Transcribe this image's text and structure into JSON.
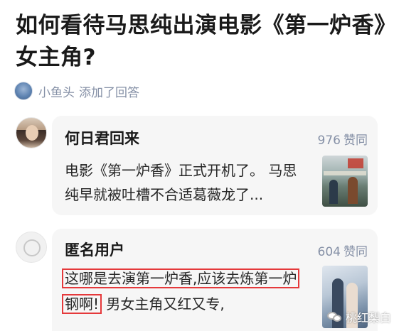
{
  "question": {
    "title": "如何看待马思纯出演电影《第一炉香》女主角?"
  },
  "activity": {
    "user": "小鱼头",
    "action": "添加了回答"
  },
  "comments": [
    {
      "author": "何日君回来",
      "votes": "976",
      "votes_label": "赞同",
      "text": "电影《第一炉香》正式开机了。 马思纯早就被吐槽不合适葛薇龙了..."
    },
    {
      "author": "匿名用户",
      "votes": "604",
      "votes_label": "赞同",
      "highlight": "这哪是去演第一炉香,应该去炼第一炉钢啊!",
      "text": "男女主角又红又专,"
    }
  ],
  "watermark": {
    "text": "桃红梨白"
  },
  "colors": {
    "accent_highlight": "#e5393b",
    "meta_text": "#8590a6",
    "card_bg": "#f6f6f6"
  }
}
